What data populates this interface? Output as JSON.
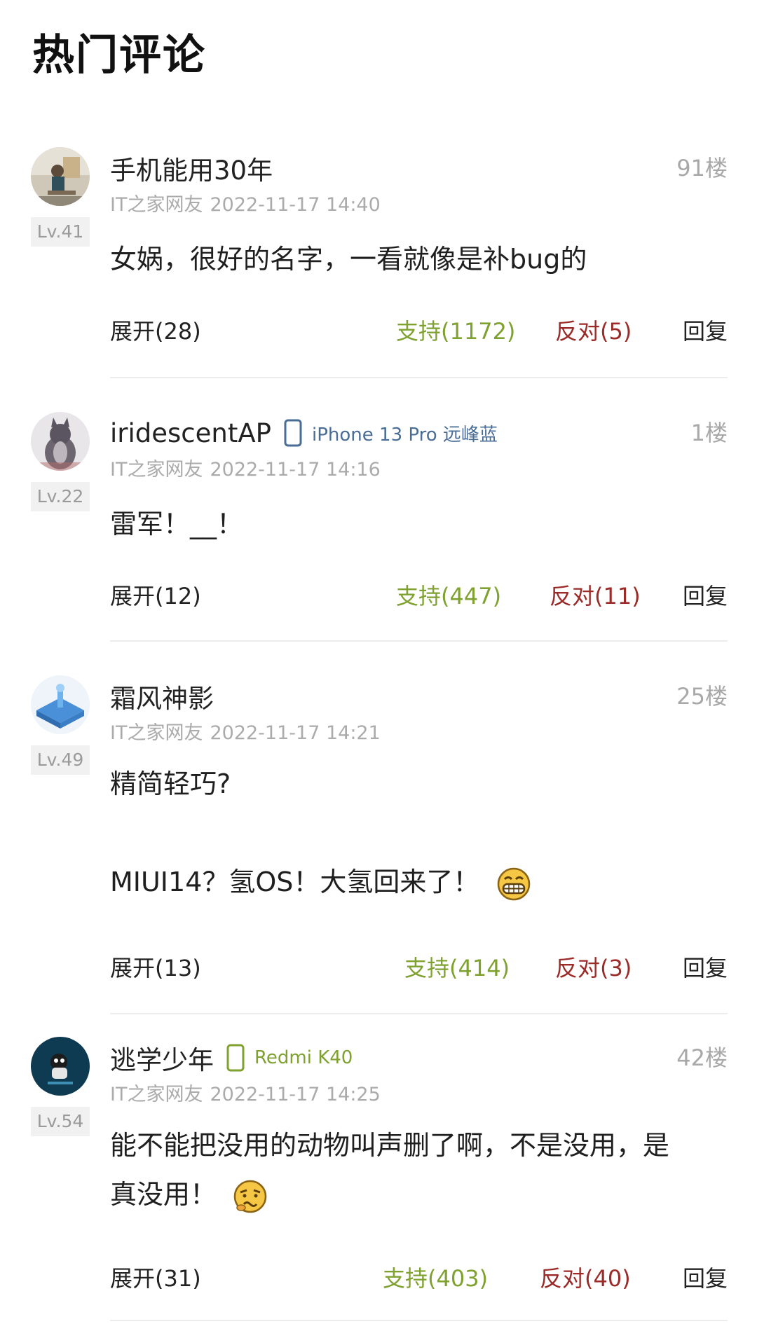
{
  "header": {
    "title": "热门评论"
  },
  "comments": [
    {
      "username": "手机能用30年",
      "device": "",
      "floor": "91楼",
      "source": "IT之家网友",
      "time": "2022-11-17 14:40",
      "level": "Lv.41",
      "lines": [
        "女娲，很好的名字，一看就像是补bug的"
      ],
      "expand": "展开(28)",
      "support": "支持(1172)",
      "oppose": "反对(5)",
      "reply": "回复"
    },
    {
      "username": "iridescentAP",
      "device": "iPhone 13 Pro 远峰蓝",
      "device_color": "#4a6d96",
      "floor": "1楼",
      "source": "IT之家网友",
      "time": "2022-11-17 14:16",
      "level": "Lv.22",
      "lines": [
        "雷军！__！"
      ],
      "expand": "展开(12)",
      "support": "支持(447)",
      "oppose": "反对(11)",
      "reply": "回复"
    },
    {
      "username": "霜风神影",
      "device": "",
      "floor": "25楼",
      "source": "IT之家网友",
      "time": "2022-11-17 14:21",
      "level": "Lv.49",
      "lines": [
        "精简轻巧?",
        "",
        "MIUI14？氢OS！大氢回来了！"
      ],
      "emoji": "grin-emoji",
      "expand": "展开(13)",
      "support": "支持(414)",
      "oppose": "反对(3)",
      "reply": "回复"
    },
    {
      "username": "逃学少年",
      "device": "Redmi K40",
      "device_color": "#7ea12f",
      "floor": "42楼",
      "source": "IT之家网友",
      "time": "2022-11-17 14:25",
      "level": "Lv.54",
      "lines": [
        "能不能把没用的动物叫声删了啊，不是没用，是",
        "真没用！"
      ],
      "emoji": "puzzled-emoji",
      "expand": "展开(31)",
      "support": "支持(403)",
      "oppose": "反对(40)",
      "reply": "回复"
    }
  ]
}
